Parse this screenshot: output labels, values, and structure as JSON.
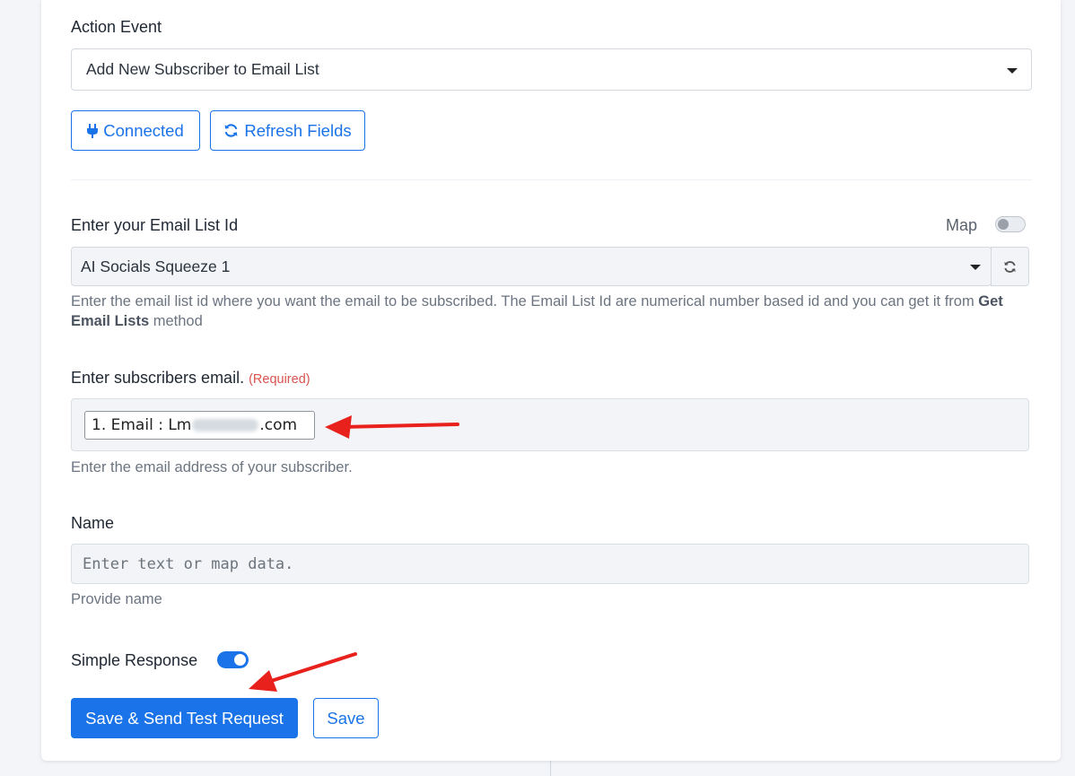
{
  "action_event": {
    "label": "Action Event",
    "selected": "Add New Subscriber to Email List"
  },
  "buttons": {
    "connected": "Connected",
    "refresh_fields": "Refresh Fields",
    "save_send": "Save & Send Test Request",
    "save": "Save"
  },
  "email_list": {
    "label": "Enter your Email List Id",
    "map_label": "Map",
    "selected": "AI Socials Squeeze 1",
    "help_prefix": "Enter the email list id where you want the email to be subscribed. The Email List Id are numerical number based id and you can get it from ",
    "help_bold": "Get Email Lists",
    "help_suffix": " method"
  },
  "subscriber_email": {
    "label": "Enter subscribers email.",
    "required": "(Required)",
    "pill_prefix": "1. Email : Lm",
    "pill_suffix": ".com",
    "help": "Enter the email address of your subscriber."
  },
  "name": {
    "label": "Name",
    "placeholder": "Enter text or map data.",
    "help": "Provide name"
  },
  "simple_response": {
    "label": "Simple Response",
    "on": true
  },
  "colors": {
    "accent": "#1a73e8",
    "required": "#d9534f",
    "annotation_arrow": "#e8211c"
  }
}
